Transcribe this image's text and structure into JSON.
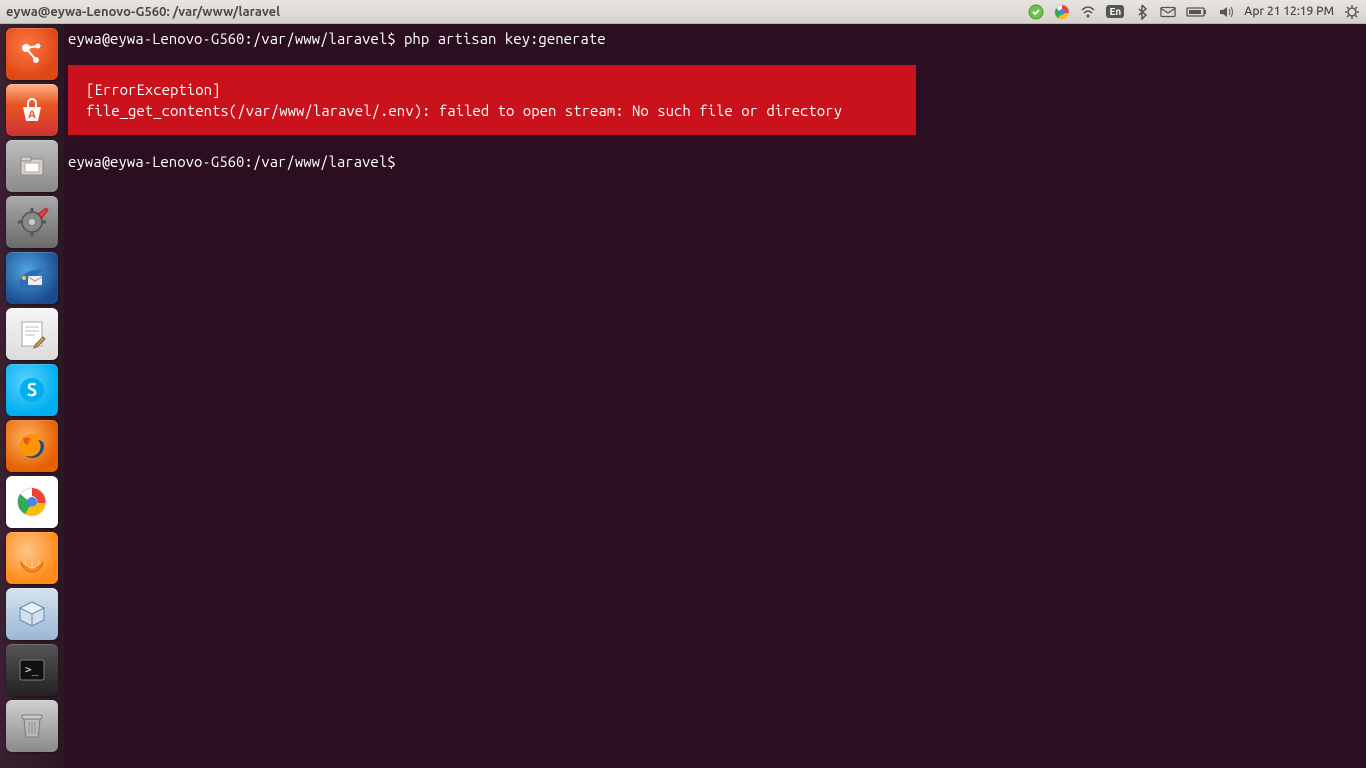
{
  "menubar": {
    "window_title": "eywa@eywa-Lenovo-G560: /var/www/laravel",
    "lang_label": "En",
    "datetime": "Apr 21 12:19 PM"
  },
  "launcher": {
    "items": [
      {
        "name": "dash-home-icon",
        "label": "Dash",
        "bg": "#dd4814"
      },
      {
        "name": "software-center-icon",
        "label": "Software Center",
        "bg": "#e95420"
      },
      {
        "name": "files-icon",
        "label": "Files",
        "bg": "#8a8a8a"
      },
      {
        "name": "settings-icon",
        "label": "System Settings",
        "bg": "#7a7a7a"
      },
      {
        "name": "thunderbird-icon",
        "label": "Thunderbird",
        "bg": "#1a4b8c"
      },
      {
        "name": "text-editor-icon",
        "label": "Text Editor",
        "bg": "#e6e6e6"
      },
      {
        "name": "skype-icon",
        "label": "Skype",
        "bg": "#00aff0"
      },
      {
        "name": "firefox-icon",
        "label": "Firefox",
        "bg": "#e66000"
      },
      {
        "name": "chrome-icon",
        "label": "Chrome",
        "bg": "#ffffff"
      },
      {
        "name": "clementine-icon",
        "label": "Clementine",
        "bg": "#ff8c1a"
      },
      {
        "name": "virtualbox-icon",
        "label": "VirtualBox",
        "bg": "#9bb7d4"
      },
      {
        "name": "terminal-icon",
        "label": "Terminal",
        "bg": "#333333"
      },
      {
        "name": "trash-icon",
        "label": "Trash",
        "bg": "#9a9a9a"
      }
    ]
  },
  "terminal": {
    "prompt1_user": "eywa@eywa-Lenovo-G560",
    "prompt1_path": "/var/www/laravel",
    "prompt1_sep1": ":",
    "prompt1_sep2": "$",
    "command1": "php artisan key:generate",
    "error_title": "[ErrorException]",
    "error_body": "file_get_contents(/var/www/laravel/.env): failed to open stream: No such file or directory",
    "prompt2_user": "eywa@eywa-Lenovo-G560",
    "prompt2_path": "/var/www/laravel",
    "prompt2_sep1": ":",
    "prompt2_sep2": "$"
  }
}
